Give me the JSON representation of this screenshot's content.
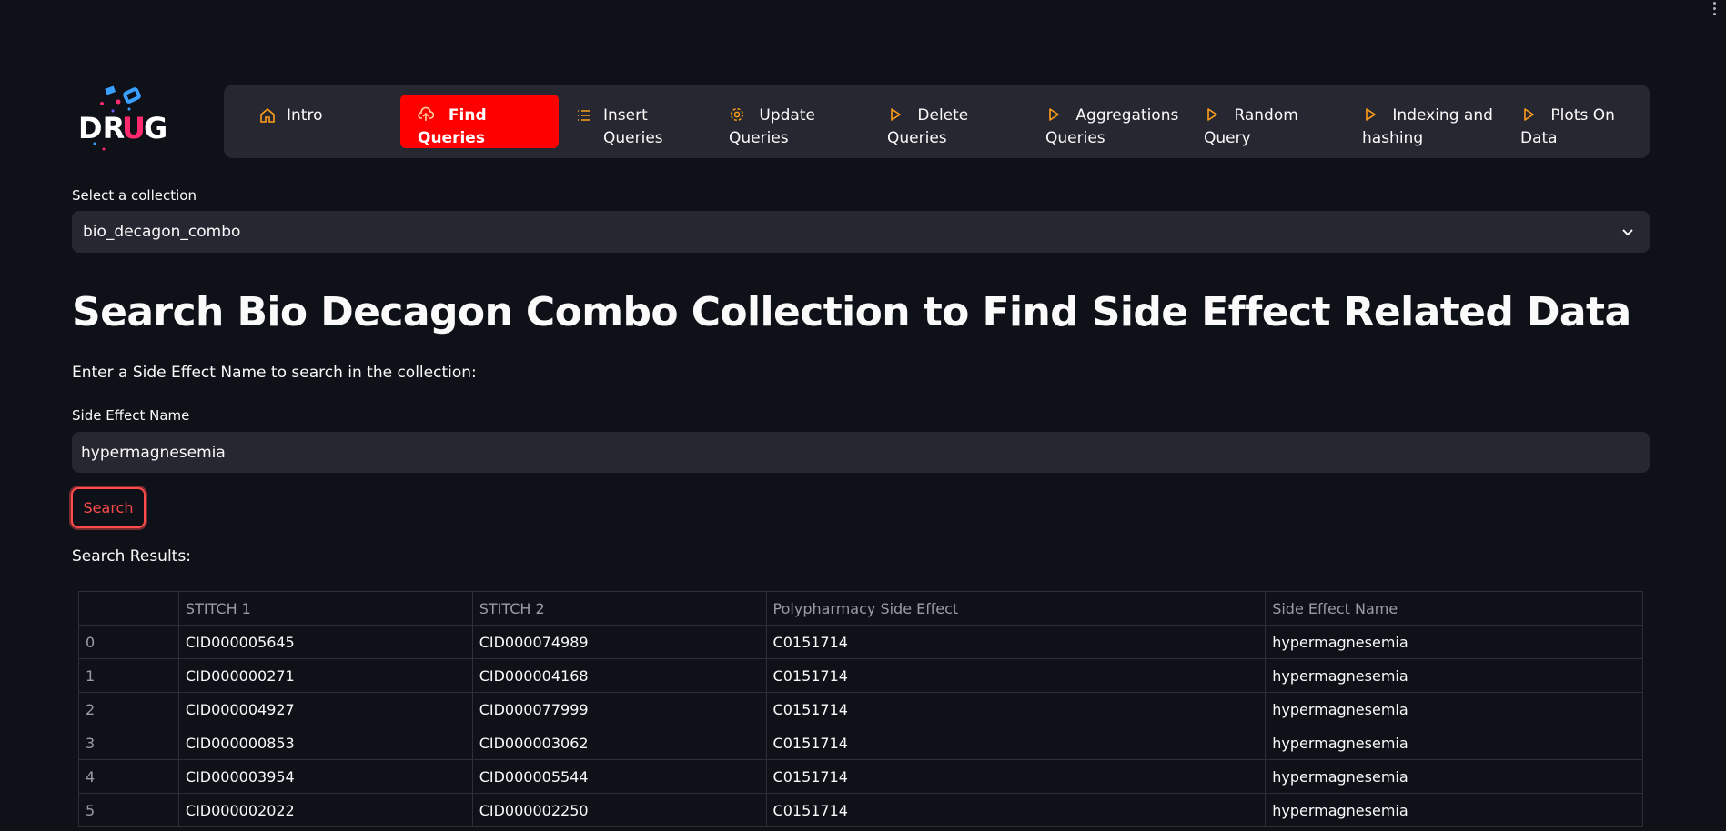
{
  "nav": {
    "items": [
      {
        "label": "Intro",
        "icon": "home-icon"
      },
      {
        "label": "Find Queries",
        "icon": "cloud-upload-icon",
        "active": true
      },
      {
        "label": "Insert Queries",
        "icon": "list-icon"
      },
      {
        "label": "Update Queries",
        "icon": "gear-icon"
      },
      {
        "label": "Delete Queries",
        "icon": "play-outline-icon"
      },
      {
        "label": "Aggregations Queries",
        "icon": "play-outline-icon"
      },
      {
        "label": "Random Query",
        "icon": "play-outline-icon"
      },
      {
        "label": "Indexing and hashing",
        "icon": "play-outline-icon"
      },
      {
        "label": "Plots On Data",
        "icon": "play-outline-icon"
      }
    ]
  },
  "collection": {
    "label": "Select a collection",
    "selected": "bio_decagon_combo"
  },
  "page": {
    "title": "Search Bio Decagon Combo Collection to Find Side Effect Related Data",
    "instruction": "Enter a Side Effect Name to search in the collection:"
  },
  "search": {
    "field_label": "Side Effect Name",
    "value": "hypermagnesemia",
    "button_label": "Search"
  },
  "results": {
    "label": "Search Results:",
    "columns": [
      "",
      "STITCH 1",
      "STITCH 2",
      "Polypharmacy Side Effect",
      "Side Effect Name"
    ],
    "rows": [
      [
        "0",
        "CID000005645",
        "CID000074989",
        "C0151714",
        "hypermagnesemia"
      ],
      [
        "1",
        "CID000000271",
        "CID000004168",
        "C0151714",
        "hypermagnesemia"
      ],
      [
        "2",
        "CID000004927",
        "CID000077999",
        "C0151714",
        "hypermagnesemia"
      ],
      [
        "3",
        "CID000000853",
        "CID000003062",
        "C0151714",
        "hypermagnesemia"
      ],
      [
        "4",
        "CID000003954",
        "CID000005544",
        "C0151714",
        "hypermagnesemia"
      ],
      [
        "5",
        "CID000002022",
        "CID000002250",
        "C0151714",
        "hypermagnesemia"
      ]
    ]
  },
  "colors": {
    "background": "#0e1117",
    "panel": "#262730",
    "active_nav": "#ff0000",
    "accent": "#ff4b4b",
    "icon_orange": "#ff9f1a"
  }
}
